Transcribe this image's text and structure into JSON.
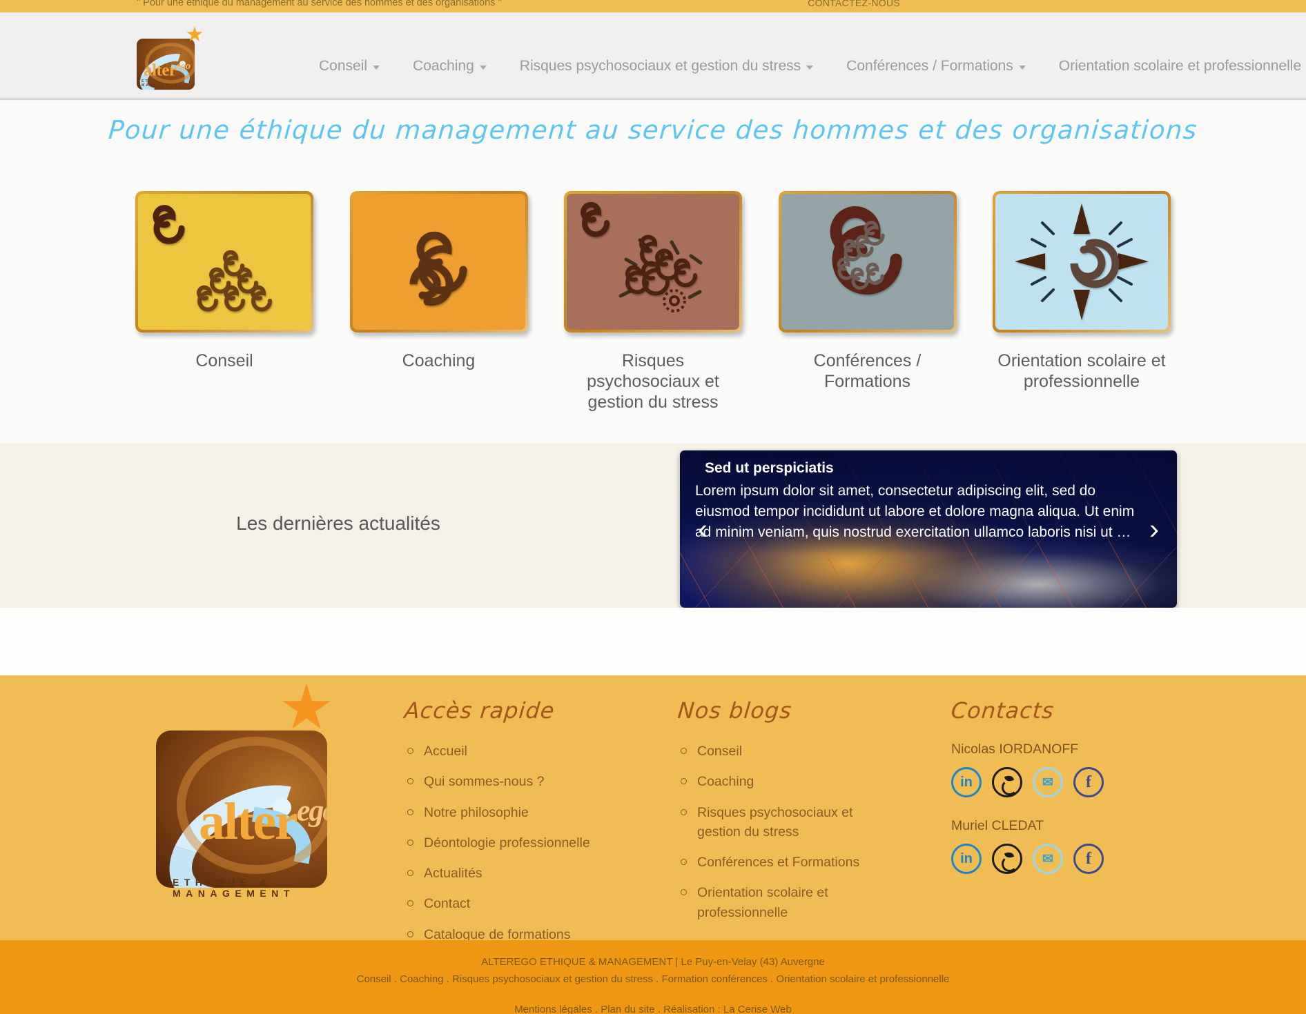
{
  "topbar": {
    "slogan": "\" Pour une éthique du management au service des hommes et des organisations \"",
    "contact_link": "CONTACTEZ-NOUS"
  },
  "header": {
    "logo": {
      "word": "alter",
      "word_sup": "ego",
      "tagline": "ETHIQUE & MANAGEMENT"
    },
    "nav": [
      {
        "label": "Conseil",
        "has_dropdown": true
      },
      {
        "label": "Coaching",
        "has_dropdown": true
      },
      {
        "label": "Risques psychosociaux et gestion du stress",
        "has_dropdown": true
      },
      {
        "label": "Conférences / Formations",
        "has_dropdown": true
      },
      {
        "label": "Orientation scolaire et professionnelle",
        "has_dropdown": true
      }
    ]
  },
  "hero": {
    "title": "Pour une éthique du management au service des hommes et des organisations",
    "title_color": "#5ec5ef",
    "cards": [
      {
        "label": "Conseil",
        "bg": "#ecc63f",
        "icon": "spiral-cluster-icon"
      },
      {
        "label": "Coaching",
        "bg": "#ef9f30",
        "icon": "double-spiral-icon"
      },
      {
        "label": "Risques psychosociaux et gestion du stress",
        "bg": "#a8705b",
        "icon": "spiral-burst-gear-icon"
      },
      {
        "label": "Conférences / Formations",
        "bg": "#93a3a6",
        "icon": "nested-spiral-icon"
      },
      {
        "label": "Orientation scolaire et professionnelle",
        "bg": "#bfe2f0",
        "icon": "compass-rose-spiral-icon"
      }
    ]
  },
  "news": {
    "title": "Les dernières actualités",
    "carousel": {
      "heading": "Sed ut perspiciatis",
      "body": "Lorem ipsum dolor sit amet, consectetur adipiscing elit, sed do eiusmod tempor incididunt ut labore et dolore magna aliqua. Ut enim ad minim veniam, quis nostrud exercitation ullamco laboris nisi ut  …",
      "prev": "‹",
      "next": "›"
    }
  },
  "footer": {
    "logo": {
      "word": "alter",
      "word_sup": "ego",
      "tagline": "ETHIQUE & MANAGEMENT"
    },
    "quick_access": {
      "title": "Accès rapide",
      "items": [
        "Accueil",
        "Qui sommes-nous ?",
        "Notre philosophie",
        "Déontologie professionnelle",
        "Actualités",
        "Contact",
        "Catalogue de formations"
      ]
    },
    "blogs": {
      "title": "Nos blogs",
      "items": [
        "Conseil",
        "Coaching",
        "Risques psychosociaux et gestion du stress",
        "Conférences et Formations",
        "Orientation scolaire et professionnelle"
      ]
    },
    "contacts": {
      "title": "Contacts",
      "people": [
        {
          "name": "Nicolas IORDANOFF",
          "socials": [
            {
              "icon": "linkedin-icon",
              "glyph": "in",
              "color": "#1b83c6"
            },
            {
              "icon": "viadeo-icon",
              "glyph": "",
              "color": "#1c1c1c"
            },
            {
              "icon": "email-icon",
              "glyph": "✉",
              "color": "#9ad4ef"
            },
            {
              "icon": "facebook-icon",
              "glyph": "f",
              "color": "#3b4a8c"
            }
          ]
        },
        {
          "name": "Muriel CLEDAT",
          "socials": [
            {
              "icon": "linkedin-icon",
              "glyph": "in",
              "color": "#1b83c6"
            },
            {
              "icon": "viadeo-icon",
              "glyph": "",
              "color": "#1c1c1c"
            },
            {
              "icon": "email-icon",
              "glyph": "✉",
              "color": "#9ad4ef"
            },
            {
              "icon": "facebook-icon",
              "glyph": "f",
              "color": "#3b4a8c"
            }
          ]
        }
      ]
    }
  },
  "bottombar": {
    "line1": "ALTEREGO ETHIQUE & MANAGEMENT | Le Puy-en-Velay (43) Auvergne",
    "line2": "Conseil . Coaching . Risques psychosociaux et gestion du stress . Formation conférences . Orientation scolaire et professionnelle",
    "legal": "Mentions légales . Plan du site . Réalisation : La Cerise Web"
  }
}
